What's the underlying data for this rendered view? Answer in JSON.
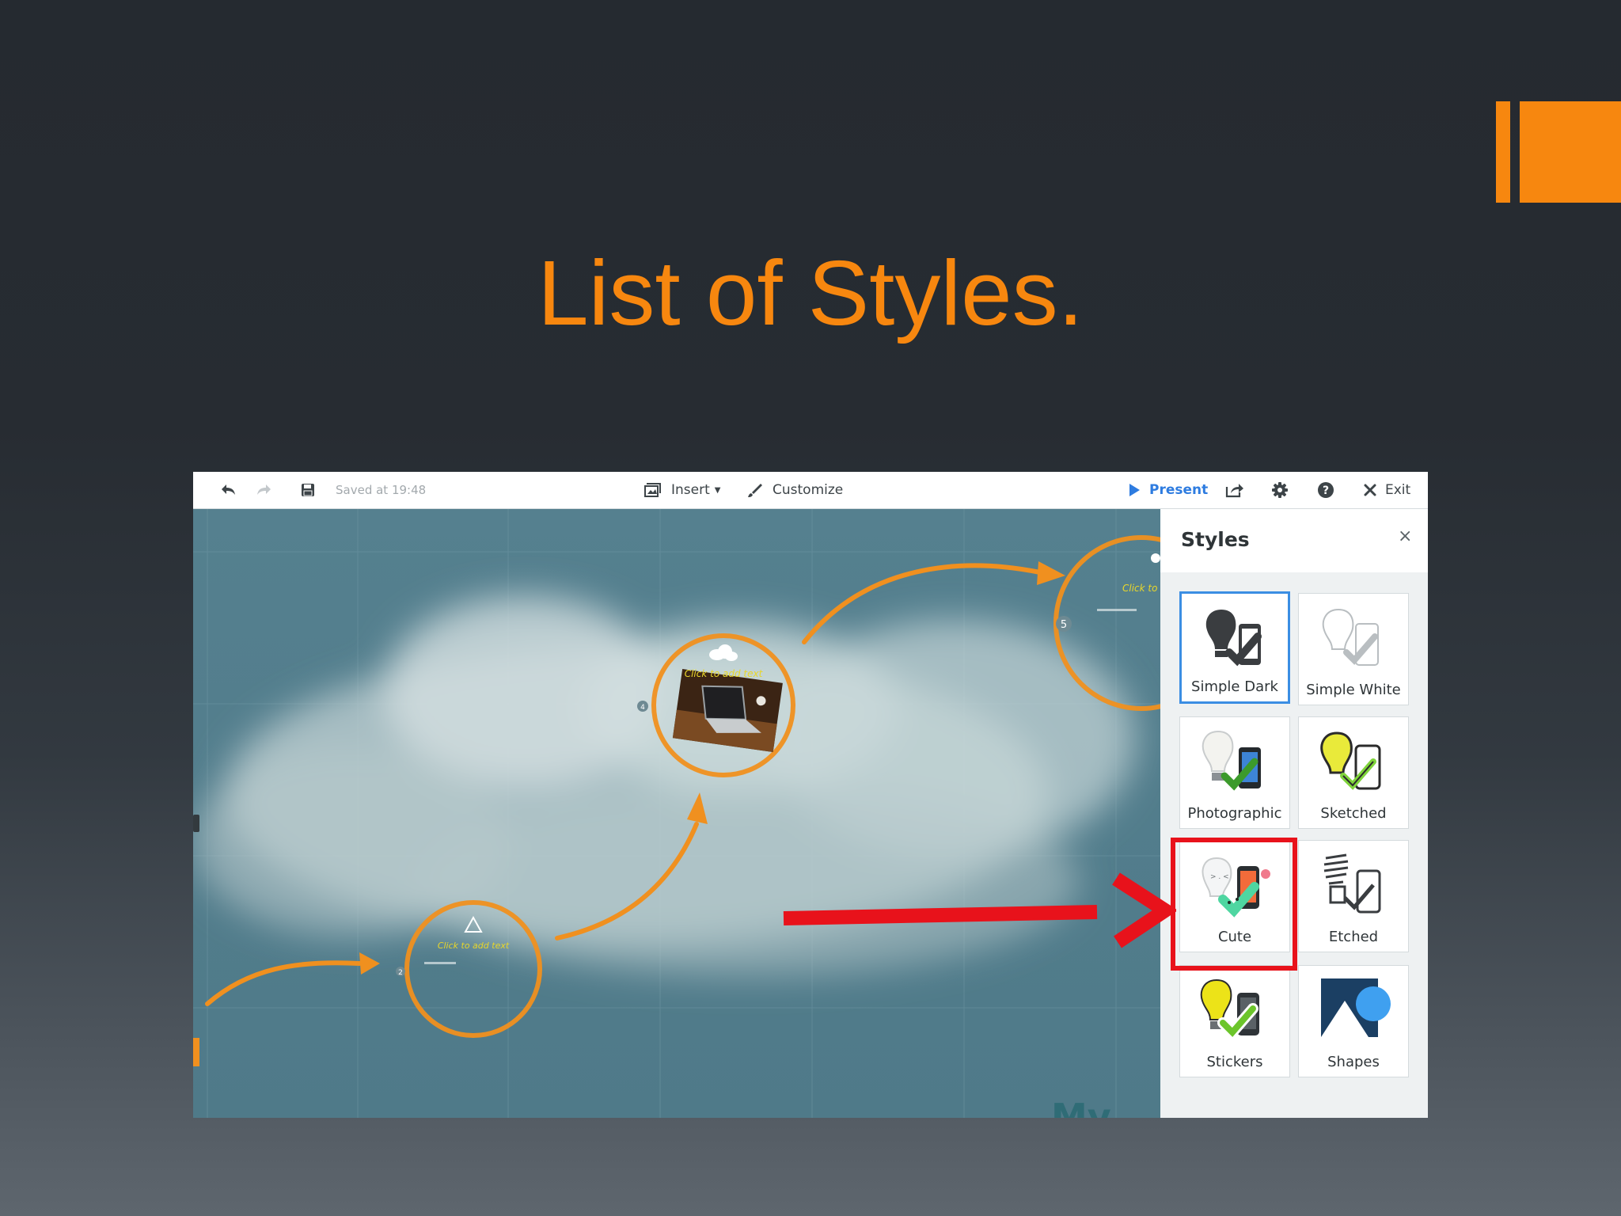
{
  "slide": {
    "title": "List of Styles.",
    "accent_color": "#f7870f"
  },
  "toolbar": {
    "undo_icon": "undo-icon",
    "redo_icon": "redo-icon",
    "save_icon": "save-icon",
    "saved_status": "Saved at 19:48",
    "insert_label": "Insert",
    "customize_label": "Customize",
    "present_label": "Present",
    "exit_label": "Exit"
  },
  "canvas": {
    "topic_numbers": [
      "2",
      "4",
      "5"
    ],
    "placeholder_text": "Click to add text",
    "partial_text": "Click to a",
    "corner_text": "My"
  },
  "styles_panel": {
    "title": "Styles",
    "close_symbol": "×",
    "items": [
      {
        "label": "Simple Dark",
        "selected": true
      },
      {
        "label": "Simple White",
        "selected": false
      },
      {
        "label": "Photographic",
        "selected": false
      },
      {
        "label": "Sketched",
        "selected": false
      },
      {
        "label": "Cute",
        "selected": false,
        "highlighted": true
      },
      {
        "label": "Etched",
        "selected": false
      },
      {
        "label": "Stickers",
        "selected": false
      },
      {
        "label": "Shapes",
        "selected": false
      }
    ]
  },
  "colors": {
    "accent_orange": "#f7870f",
    "present_blue": "#2e7ce0",
    "selection_blue": "#3b8ee3",
    "annotation_red": "#e8121b"
  }
}
